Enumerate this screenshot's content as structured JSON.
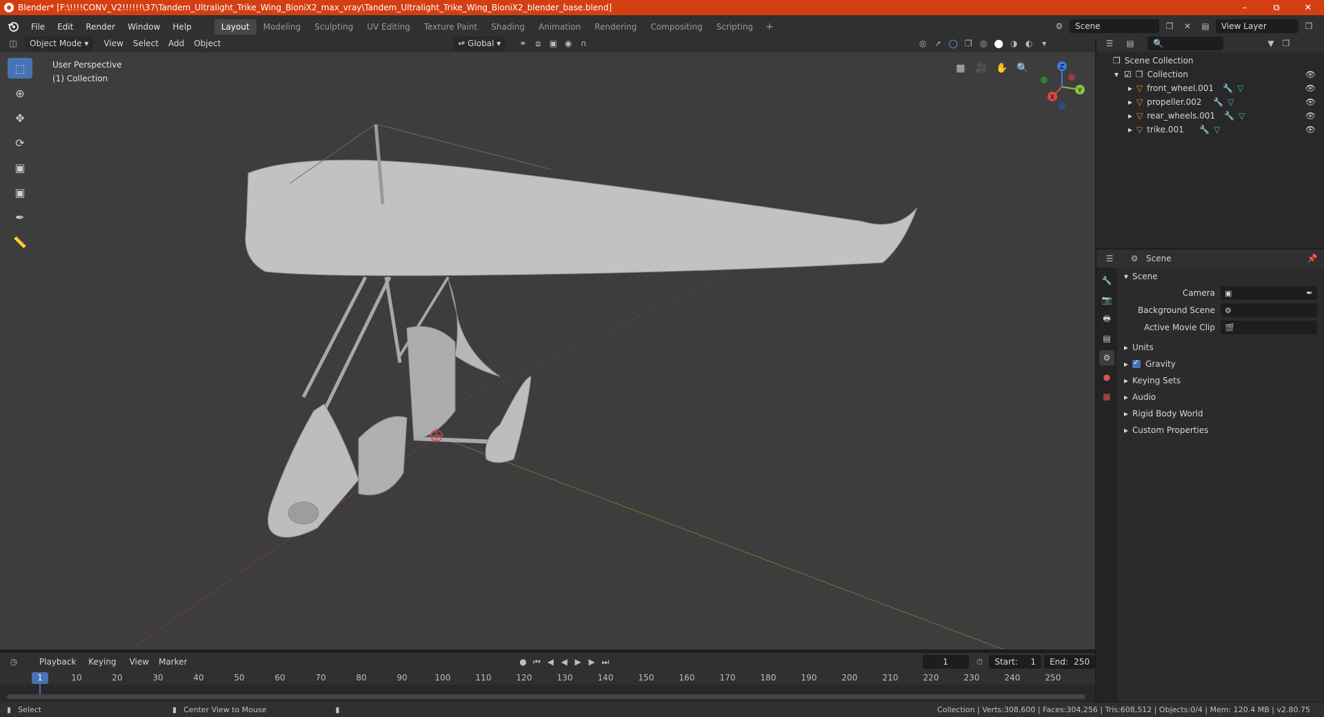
{
  "window": {
    "title": "Blender* [F:\\!!!!CONV_V2!!!!!!\\37\\Tandem_Ultralight_Trike_Wing_BioniX2_max_vray\\Tandem_Ultralight_Trike_Wing_BioniX2_blender_base.blend]"
  },
  "menu": {
    "file": "File",
    "edit": "Edit",
    "render": "Render",
    "window": "Window",
    "help": "Help"
  },
  "workspaces": [
    "Layout",
    "Modeling",
    "Sculpting",
    "UV Editing",
    "Texture Paint",
    "Shading",
    "Animation",
    "Rendering",
    "Compositing",
    "Scripting"
  ],
  "scene_selector": {
    "scene": "Scene",
    "view_layer": "View Layer"
  },
  "viewport_header": {
    "mode": "Object Mode",
    "view": "View",
    "select": "Select",
    "add": "Add",
    "object": "Object",
    "orientation": "Global"
  },
  "viewport": {
    "perspective": "User Perspective",
    "collection": "(1) Collection",
    "gizmo": {
      "x": "X",
      "y": "Y",
      "z": "Z"
    }
  },
  "timeline": {
    "playback": "Playback",
    "keying": "Keying",
    "view": "View",
    "marker": "Marker",
    "current_frame": "1",
    "start_label": "Start:",
    "start": "1",
    "end_label": "End:",
    "end": "250",
    "ruler": [
      "1",
      "10",
      "20",
      "30",
      "40",
      "50",
      "60",
      "70",
      "80",
      "90",
      "100",
      "110",
      "120",
      "130",
      "140",
      "150",
      "160",
      "170",
      "180",
      "190",
      "200",
      "210",
      "220",
      "230",
      "240",
      "250"
    ]
  },
  "statusbar": {
    "select": "Select",
    "center": "Center View to Mouse",
    "stats": "Collection | Verts:308,600 | Faces:304,256 | Tris:608,512 | Objects:0/4 | Mem: 120.4 MB | v2.80.75"
  },
  "outliner": {
    "root": "Scene Collection",
    "collection": "Collection",
    "objects": [
      "front_wheel.001",
      "propeller.002",
      "rear_wheels.001",
      "trike.001"
    ]
  },
  "properties": {
    "header": "Scene",
    "section": "Scene",
    "camera_label": "Camera",
    "background_label": "Background Scene",
    "movieclip_label": "Active Movie Clip",
    "panels": [
      "Units",
      "Gravity",
      "Keying Sets",
      "Audio",
      "Rigid Body World",
      "Custom Properties"
    ]
  },
  "colors": {
    "accent": "#4772b3",
    "titlebar": "#d33f12",
    "object_icon": "#e5902e"
  }
}
